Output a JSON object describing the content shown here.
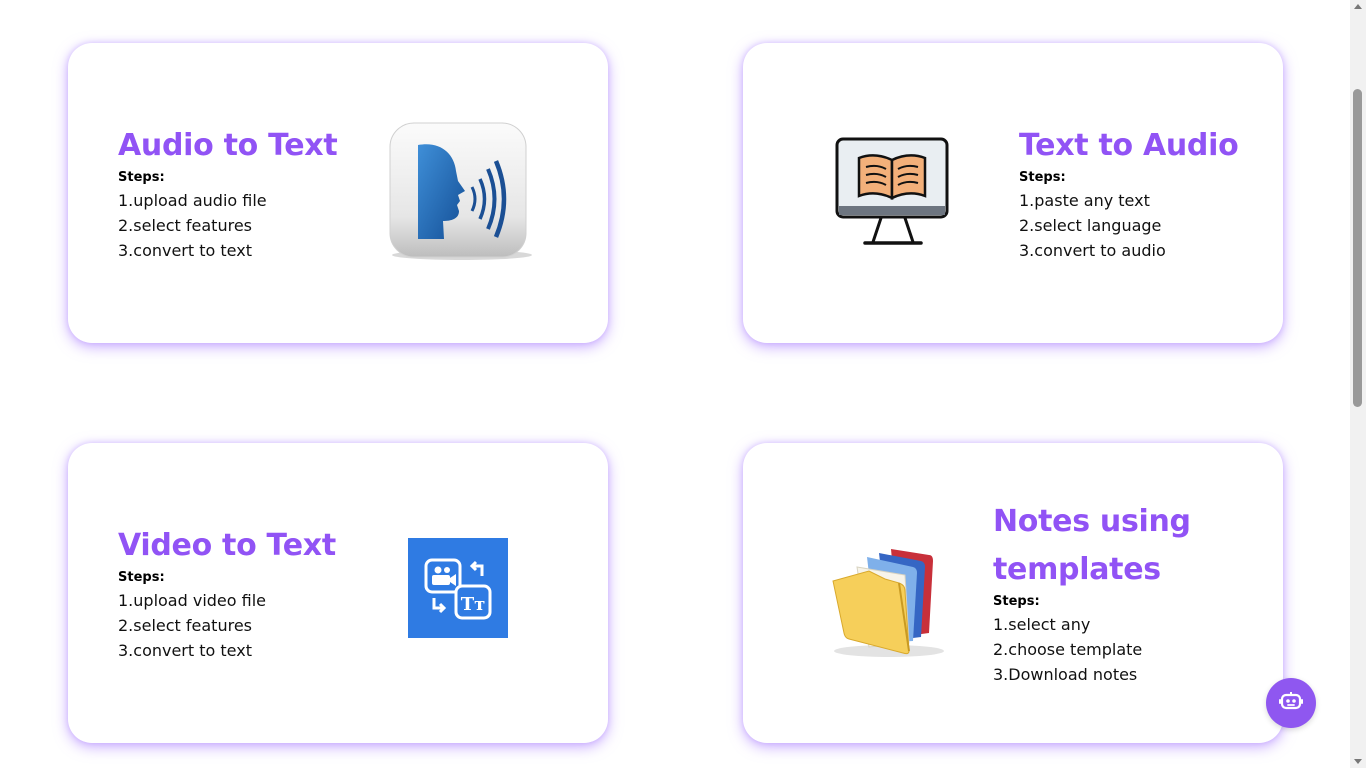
{
  "cards": [
    {
      "id": "audio-to-text",
      "title": "Audio to Text",
      "steps_label": "Steps:",
      "steps": [
        "1.upload audio file",
        "2.select features",
        "3.convert to text"
      ],
      "icon": "speaking-head-icon"
    },
    {
      "id": "text-to-audio",
      "title": "Text to Audio",
      "steps_label": "Steps:",
      "steps": [
        "1.paste any text",
        "2.select language",
        "3.convert to audio"
      ],
      "icon": "monitor-book-icon"
    },
    {
      "id": "video-to-text",
      "title": "Video to Text",
      "steps_label": "Steps:",
      "steps": [
        "1.upload video file",
        "2.select features",
        "3.convert to text"
      ],
      "icon": "video-text-convert-icon"
    },
    {
      "id": "notes-using-templates",
      "title": "Notes using templates",
      "steps_label": "Steps:",
      "steps": [
        "1.select any",
        "2.choose template",
        "3.Download notes"
      ],
      "icon": "folders-icon"
    }
  ],
  "chatbot": {
    "icon": "robot-icon"
  },
  "colors": {
    "accent": "#9153f5",
    "chat_button": "#8f57f0",
    "card_shadow": "#b48cff"
  }
}
